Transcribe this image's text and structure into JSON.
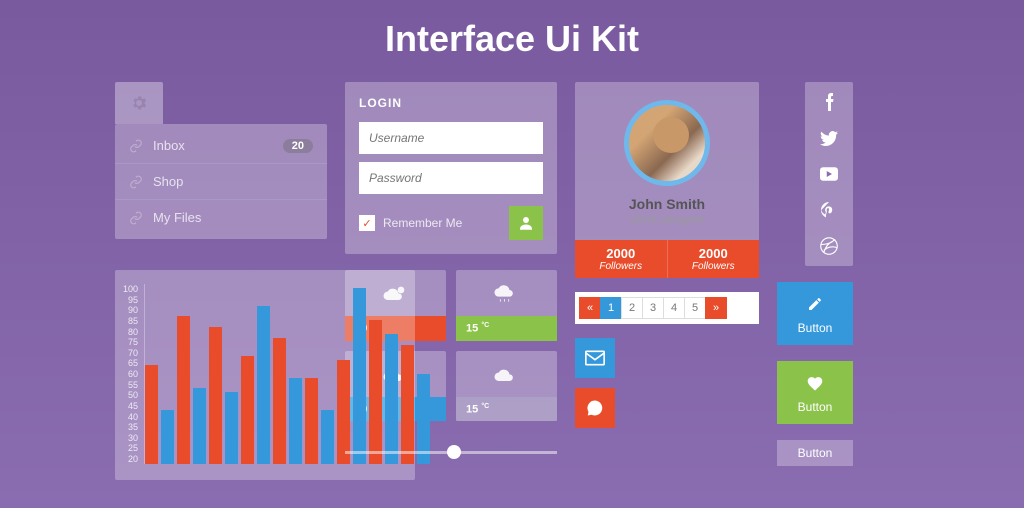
{
  "title": "Interface Ui Kit",
  "sidebar": {
    "items": [
      {
        "label": "Inbox",
        "badge": "20"
      },
      {
        "label": "Shop"
      },
      {
        "label": "My Files"
      }
    ]
  },
  "login": {
    "title": "LOGIN",
    "username_placeholder": "Username",
    "password_placeholder": "Password",
    "remember": "Remember Me"
  },
  "chart_data": {
    "type": "bar",
    "ylim": [
      0,
      100
    ],
    "yticks": [
      100,
      95,
      90,
      85,
      80,
      75,
      70,
      65,
      60,
      55,
      50,
      45,
      40,
      35,
      30,
      25,
      20
    ],
    "series": [
      {
        "name": "orange",
        "color": "#e84c2b",
        "values": [
          55,
          82,
          76,
          60,
          70,
          48,
          58,
          80,
          66
        ]
      },
      {
        "name": "blue",
        "color": "#3498db",
        "values": [
          30,
          42,
          40,
          88,
          48,
          30,
          98,
          72,
          50
        ]
      }
    ]
  },
  "weather": [
    {
      "temp": "10",
      "unit": "°C",
      "color": "orange",
      "icon": "cloud-moon"
    },
    {
      "temp": "15",
      "unit": "°C",
      "color": "green",
      "icon": "cloud-rain"
    },
    {
      "temp": "10",
      "unit": "°C",
      "color": "blue",
      "icon": "cloud"
    },
    {
      "temp": "15",
      "unit": "°C",
      "color": "gray",
      "icon": "cloud"
    }
  ],
  "profile": {
    "name": "John Smith",
    "title": "UI/UX Designer",
    "stats": [
      {
        "num": "2000",
        "label": "Followers"
      },
      {
        "num": "2000",
        "label": "Followers"
      }
    ]
  },
  "pagination": {
    "prev": "«",
    "pages": [
      "1",
      "2",
      "3",
      "4",
      "5"
    ],
    "next": "»",
    "active": 0
  },
  "buttons": {
    "b1": "Button",
    "b2": "Button",
    "b3": "Button"
  },
  "social": [
    "facebook",
    "twitter",
    "youtube",
    "pinterest",
    "dribbble"
  ]
}
